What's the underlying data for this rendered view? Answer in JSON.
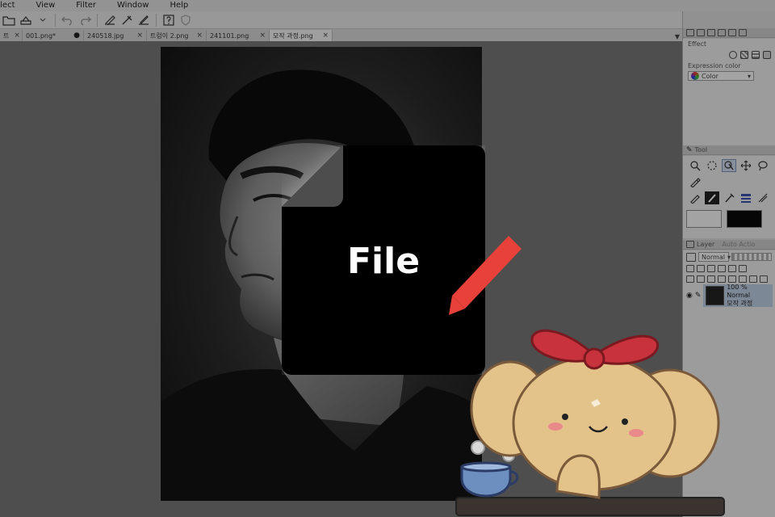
{
  "menubar": {
    "items": [
      "elect",
      "View",
      "Filter",
      "Window",
      "Help"
    ]
  },
  "tabs": [
    {
      "label": "트",
      "trail": "×",
      "active": false
    },
    {
      "label": "001.png*",
      "trail": "●",
      "active": false
    },
    {
      "label": "240518.jpg",
      "trail": "×",
      "active": false
    },
    {
      "label": "트렁이 2.png",
      "trail": "×",
      "active": false
    },
    {
      "label": "241101.png",
      "trail": "×",
      "active": false
    },
    {
      "label": "모작 과정.png",
      "trail": "×",
      "active": true
    }
  ],
  "panels": {
    "effect": {
      "title": "Effect",
      "expression_label": "Expression color",
      "color_dropdown": "Color"
    },
    "tool": {
      "title": "Tool"
    },
    "layer": {
      "title": "Layer",
      "secondary_tab": "Auto Actio",
      "blend_mode": "Normal",
      "item": {
        "opacity_mode": "100 % Normal",
        "name": "모작 과정"
      }
    }
  },
  "overlay": {
    "file_label": "File"
  },
  "colors": {
    "accent_pencil": "#e8413a",
    "file_icon": "#000000",
    "mascot_bow": "#c8323c",
    "mascot_body": "#e3c38a"
  }
}
